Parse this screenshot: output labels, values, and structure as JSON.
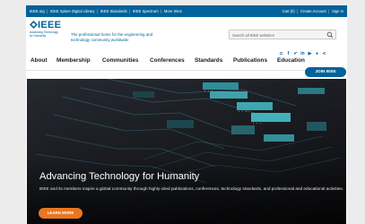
{
  "utility_bar": {
    "left_links": [
      "IEEE.org",
      "IEEE Xplore Digital Library",
      "IEEE Standards",
      "IEEE Spectrum",
      "More Sites"
    ],
    "right_links": [
      "Cart (0)",
      "Create Account",
      "Sign In"
    ]
  },
  "header": {
    "logo_text": "IEEE",
    "logo_tagline": "Advancing Technology\nfor Humanity",
    "tagline": "The professional home for the engineering and\ntechnology community worldwide",
    "search_placeholder": "Search all IEEE websites",
    "social_icons": [
      "instagram-icon",
      "facebook-icon",
      "twitter-icon",
      "linkedin-icon",
      "youtube-icon",
      "flickr-icon",
      "share-icon"
    ]
  },
  "nav": {
    "items": [
      "About",
      "Membership",
      "Communities",
      "Conferences",
      "Standards",
      "Publications",
      "Education"
    ],
    "join_label": "JOIN IEEE"
  },
  "hero": {
    "title": "Advancing Technology for Humanity",
    "description": "IEEE and its members inspire a global community through highly-cited publications, conferences, technology standards, and professional and educational activities.",
    "cta_label": "LEARN MORE"
  },
  "colors": {
    "brand_blue": "#00629b",
    "cta_orange": "#e87722",
    "hero_bg": "#1c1d22"
  }
}
